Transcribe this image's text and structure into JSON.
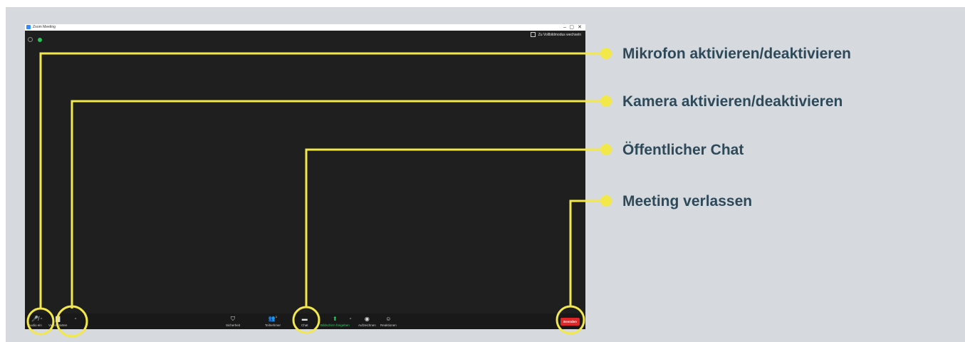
{
  "window": {
    "title": "Zoom Meeting",
    "minimize": "–",
    "maximize": "▢",
    "close": "✕",
    "fullscreen_label": "Zu Vollbildmodus wechseln"
  },
  "toolbar": {
    "audio_label": "Audio ein",
    "video_label": "Video starten",
    "security_label": "Sicherheit",
    "participants_label": "Teilnehmer",
    "participants_count": "1",
    "chat_label": "Chat",
    "share_label": "Bildschirm freigeben",
    "record_label": "Aufzeichnen",
    "reactions_label": "Reaktionen",
    "end_label": "Beenden"
  },
  "callouts": {
    "mic": "Mikrofon aktivieren/deaktivieren",
    "camera": "Kamera aktivieren/deaktivieren",
    "chat": "Öffentlicher Chat",
    "leave": "Meeting verlassen"
  },
  "colors": {
    "callout_line": "#f3e84a",
    "callout_text": "#2e4a5a",
    "end_button": "#e02828",
    "share_green": "#23d959"
  }
}
